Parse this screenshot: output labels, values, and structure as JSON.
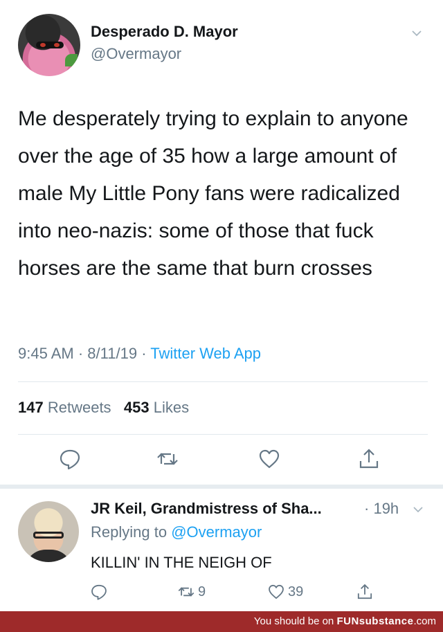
{
  "tweet": {
    "author_name": "Desperado D. Mayor",
    "author_handle": "@Overmayor",
    "text": "Me desperately trying to explain to anyone over the age of 35 how a large amount of male My Little Pony fans were radicalized into neo-nazis: some of those that fuck horses are the same that burn crosses",
    "time": "9:45 AM",
    "date": "8/11/19",
    "source": "Twitter Web App",
    "retweets_count": "147",
    "retweets_label": "Retweets",
    "likes_count": "453",
    "likes_label": "Likes",
    "icons": [
      "reply-icon",
      "retweet-icon",
      "like-icon",
      "share-icon"
    ]
  },
  "reply": {
    "author_name": "JR Keil, Grandmistress of Sha...",
    "time": "19h",
    "replying_prefix": "Replying to",
    "replying_to": "@Overmayor",
    "text": "KILLIN' IN THE NEIGH OF",
    "retweets_count": "9",
    "likes_count": "39"
  },
  "footer": {
    "prefix": "You should be on",
    "brand": "FUNsubstance",
    "suffix": ".com"
  },
  "colors": {
    "accent": "#1da1f2",
    "muted": "#657786",
    "footer_bg": "#9e2a2a"
  }
}
